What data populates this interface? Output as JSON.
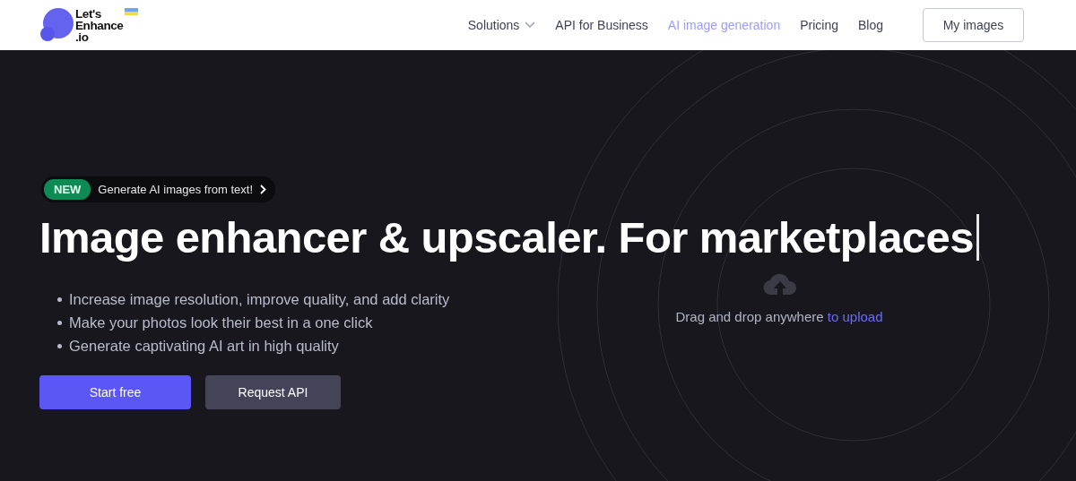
{
  "logo": {
    "lines": [
      "Let's",
      "Enhance",
      ".io"
    ]
  },
  "nav": {
    "items": [
      {
        "label": "Solutions",
        "kind": "dropdown",
        "selected": false
      },
      {
        "label": "API for Business",
        "kind": "link",
        "selected": false
      },
      {
        "label": "AI image generation",
        "kind": "link",
        "selected": true
      },
      {
        "label": "Pricing",
        "kind": "link",
        "selected": false
      },
      {
        "label": "Blog",
        "kind": "link",
        "selected": false
      }
    ],
    "button": "My images"
  },
  "hero": {
    "announcement": {
      "badge": "NEW",
      "text": "Generate AI images from text!"
    },
    "headline": "Image enhancer & upscaler. For marketplaces",
    "bullets": [
      "Increase image resolution, improve quality, and add clarity",
      "Make your photos look their best in a one click",
      "Generate captivating AI art in high quality"
    ],
    "buttons": [
      {
        "label": "Start free",
        "kind": "primary"
      },
      {
        "label": "Request API",
        "kind": "secondary"
      }
    ]
  },
  "upload": {
    "text": "Drag and drop anywhere",
    "link": "to upload"
  }
}
